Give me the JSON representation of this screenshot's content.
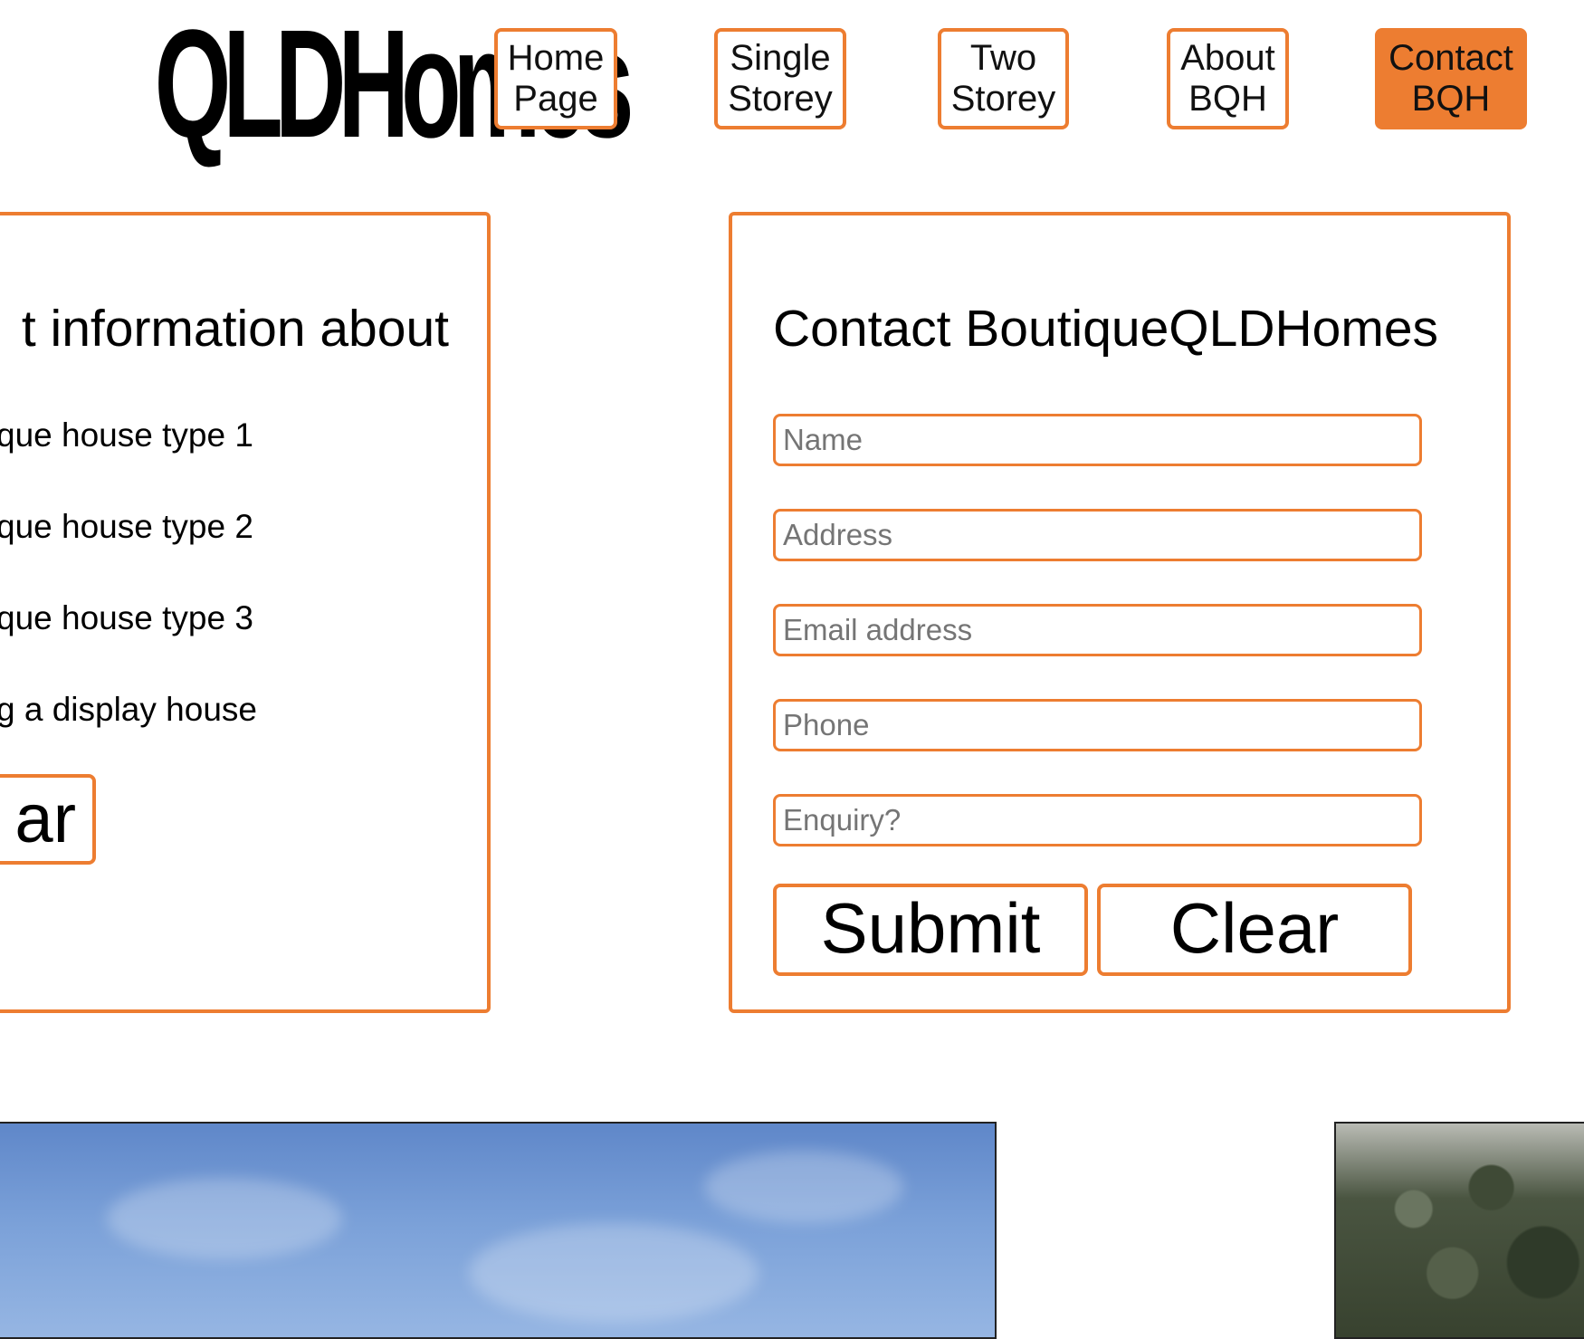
{
  "brand": {
    "logo_text": "QLDHomes"
  },
  "nav": {
    "home": "Home\nPage",
    "single": "Single\nStorey",
    "two": "Two\nStorey",
    "about": "About\nBQH",
    "contact": "Contact\nBQH",
    "active": "contact"
  },
  "info_panel": {
    "heading": "t information about",
    "options": [
      "que house type 1",
      "que house type 2",
      "que house type 3",
      "g a display house"
    ],
    "clear_label": "ar"
  },
  "contact_panel": {
    "heading": "Contact BoutiqueQLDHomes",
    "fields": {
      "name": "Name",
      "address": "Address",
      "email": "Email address",
      "phone": "Phone",
      "enquiry": "Enquiry?"
    },
    "submit_label": "Submit",
    "clear_label": "Clear"
  },
  "colors": {
    "accent": "#ed7d31",
    "text": "#000000",
    "background": "#ffffff"
  }
}
